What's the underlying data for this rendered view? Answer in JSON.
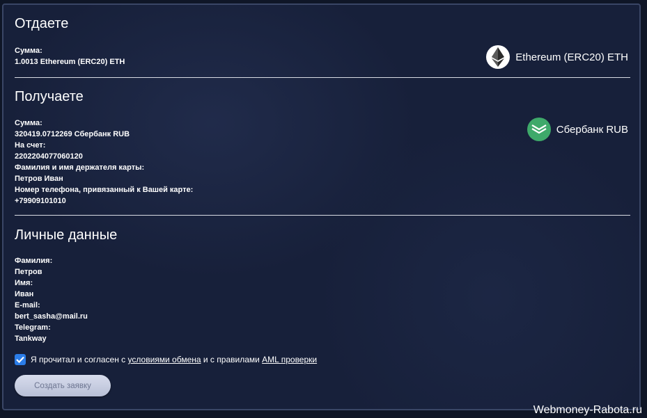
{
  "give": {
    "heading": "Отдаете",
    "amount_label": "Сумма:",
    "amount_value": "1.0013 Ethereum (ERC20) ETH",
    "currency_name": "Ethereum (ERC20) ETH",
    "currency_icon": "ethereum-icon"
  },
  "receive": {
    "heading": "Получаете",
    "amount_label": "Сумма:",
    "amount_value": "320419.0712269 Сбербанк RUB",
    "account_label": "На счет:",
    "account_value": "2202204077060120",
    "holder_label": "Фамилия и имя держателя карты:",
    "holder_value": "Петров Иван",
    "phone_label": "Номер телефона, привязанный к Вашей карте:",
    "phone_value": "+79909101010",
    "currency_name": "Сбербанк RUB",
    "currency_icon": "sberbank-icon"
  },
  "personal": {
    "heading": "Личные данные",
    "lastname_label": "Фамилия:",
    "lastname_value": "Петров",
    "firstname_label": "Имя:",
    "firstname_value": "Иван",
    "email_label": "E-mail:",
    "email_value": "bert_sasha@mail.ru",
    "telegram_label": "Telegram:",
    "telegram_value": "Tankway"
  },
  "agreement": {
    "checked": true,
    "text_1": "Я прочитал и согласен с ",
    "link_terms": "условиями обмена",
    "text_2": " и с правилами ",
    "link_aml": "AML проверки"
  },
  "submit_label": "Создать заявку",
  "watermark": "Webmoney-Rabota.ru",
  "colors": {
    "accent": "#2b7de9",
    "sber_green": "#3ea96a",
    "panel_bg": "#17203a"
  }
}
